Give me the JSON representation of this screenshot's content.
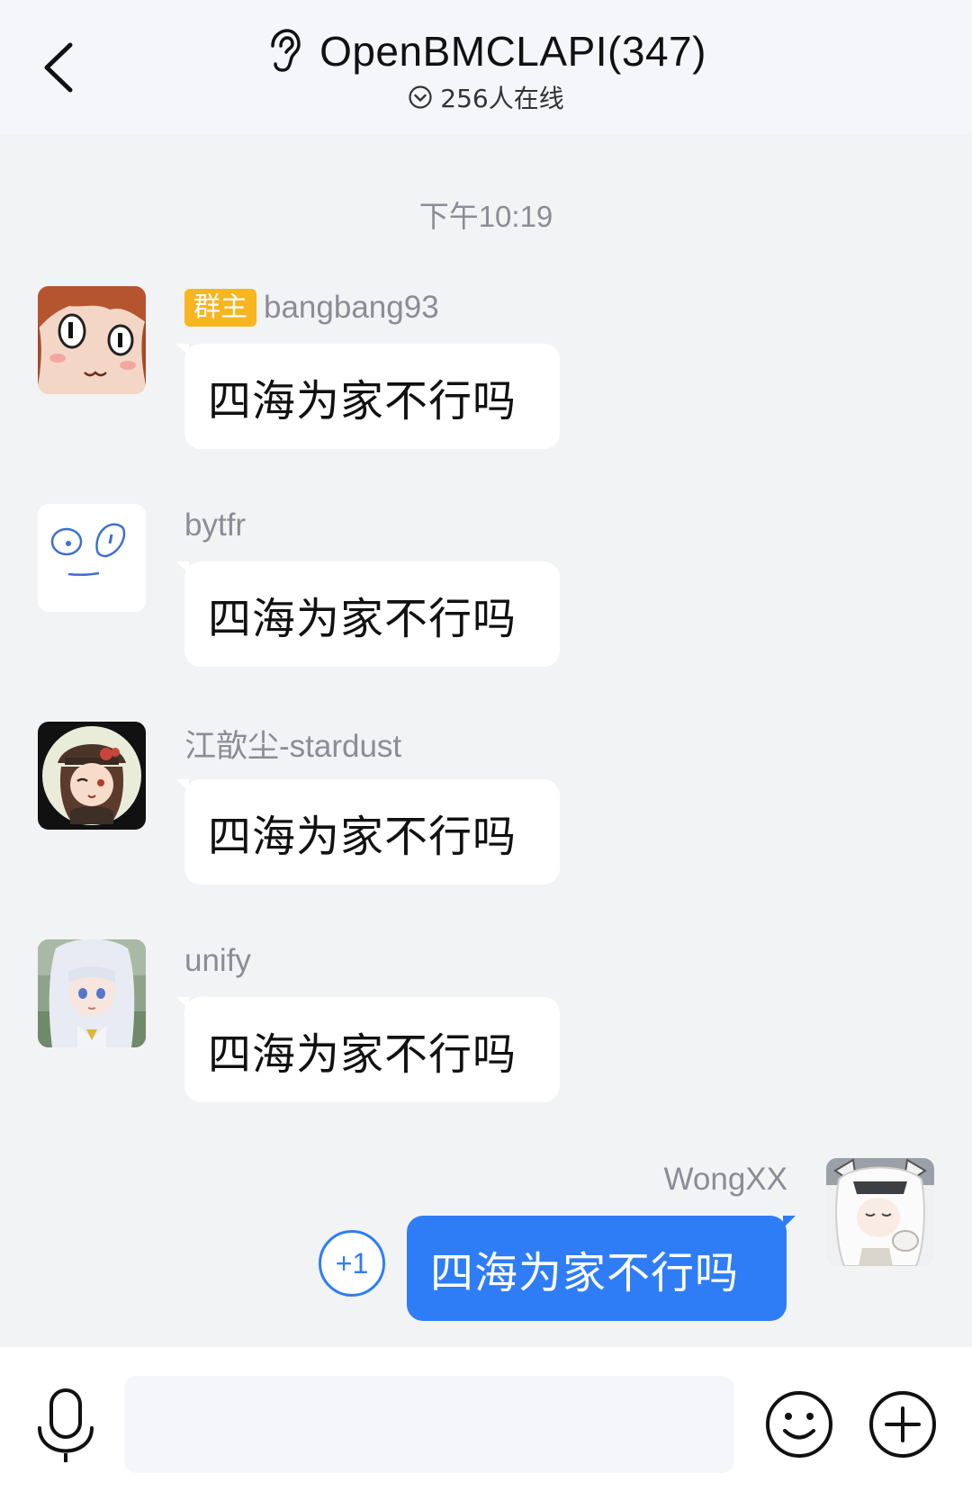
{
  "header": {
    "title": "OpenBMCLAPI(347)",
    "online": "256人在线",
    "back_icon": "chevron-left-icon",
    "listen_icon": "ear-icon"
  },
  "chat": {
    "timestamp": "下午10:19",
    "messages": [
      {
        "role_badge": "群主",
        "sender": "bangbang93",
        "text": "四海为家不行吗"
      },
      {
        "sender": "bytfr",
        "text": "四海为家不行吗"
      },
      {
        "sender": "江歆尘-stardust",
        "text": "四海为家不行吗"
      },
      {
        "sender": "unify",
        "text": "四海为家不行吗"
      }
    ],
    "self_message": {
      "sender": "WongXX",
      "text": "四海为家不行吗",
      "plus_one": "+1"
    }
  },
  "input_bar": {
    "placeholder": "",
    "icons": [
      "microphone-icon",
      "emoji-icon",
      "plus-icon"
    ]
  },
  "colors": {
    "accent": "#2f7df6",
    "owner_badge": "#f7b51f",
    "background": "#f2f3f5"
  }
}
